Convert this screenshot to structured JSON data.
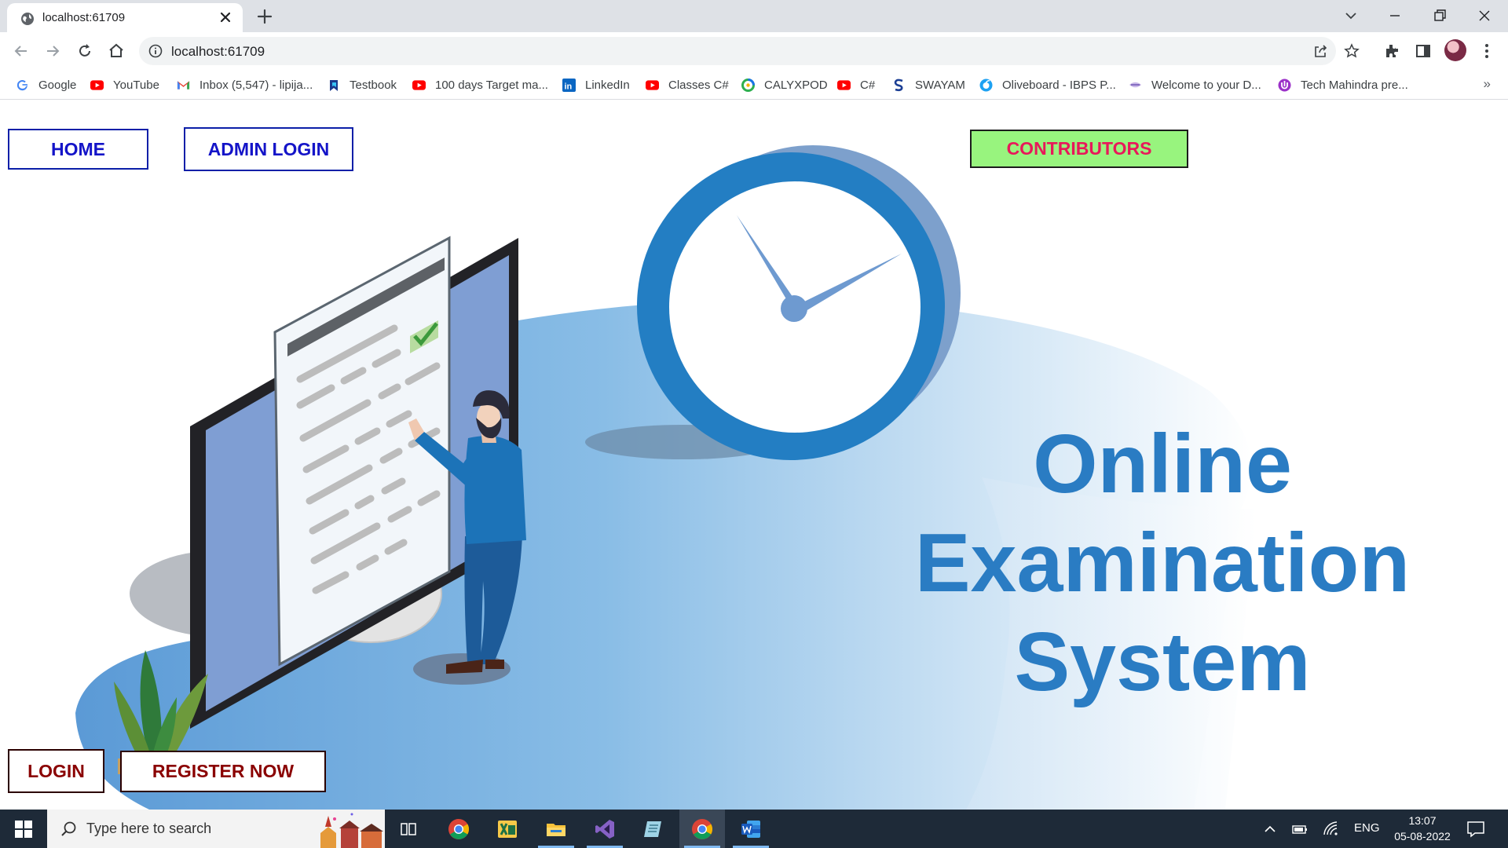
{
  "browser": {
    "tab": {
      "title": "localhost:61709"
    },
    "address_bar": {
      "url": "localhost:61709"
    },
    "bookmarks": [
      {
        "label": "Google",
        "icon": "google-icon"
      },
      {
        "label": "YouTube",
        "icon": "youtube-icon"
      },
      {
        "label": "Inbox (5,547) - lipija...",
        "icon": "gmail-icon"
      },
      {
        "label": "Testbook",
        "icon": "testbook-icon"
      },
      {
        "label": "100 days Target ma...",
        "icon": "youtube-icon"
      },
      {
        "label": "LinkedIn",
        "icon": "linkedin-icon"
      },
      {
        "label": "Classes C#",
        "icon": "youtube-icon"
      },
      {
        "label": "CALYXPOD",
        "icon": "calyxpod-icon"
      },
      {
        "label": "C#",
        "icon": "youtube-icon"
      },
      {
        "label": "SWAYAM",
        "icon": "swayam-icon"
      },
      {
        "label": "Oliveboard - IBPS P...",
        "icon": "oliveboard-icon"
      },
      {
        "label": "Welcome to your D...",
        "icon": "welcome-icon"
      },
      {
        "label": "Tech Mahindra pre...",
        "icon": "techmahindra-icon"
      }
    ],
    "bookmarks_more": "»"
  },
  "page": {
    "nav": {
      "home": "HOME",
      "admin_login": "ADMIN LOGIN",
      "contributors": "CONTRIBUTORS"
    },
    "headline": [
      "Online",
      "Examination",
      "System"
    ],
    "actions": {
      "login": "LOGIN",
      "register": "REGISTER NOW"
    },
    "colors": {
      "headline": "#2a7cc3",
      "nav_text": "#1414c8",
      "contributors_bg": "#98f47e",
      "contributors_text": "#e8185a",
      "action_text": "#8a0000"
    }
  },
  "taskbar": {
    "search_placeholder": "Type here to search",
    "apps": [
      "task-view-icon",
      "chrome-icon",
      "excel-icon",
      "file-explorer-icon",
      "visual-studio-icon",
      "notepad-icon",
      "chrome-icon",
      "word-icon"
    ],
    "language": "ENG",
    "time": "13:07",
    "date": "05-08-2022"
  }
}
